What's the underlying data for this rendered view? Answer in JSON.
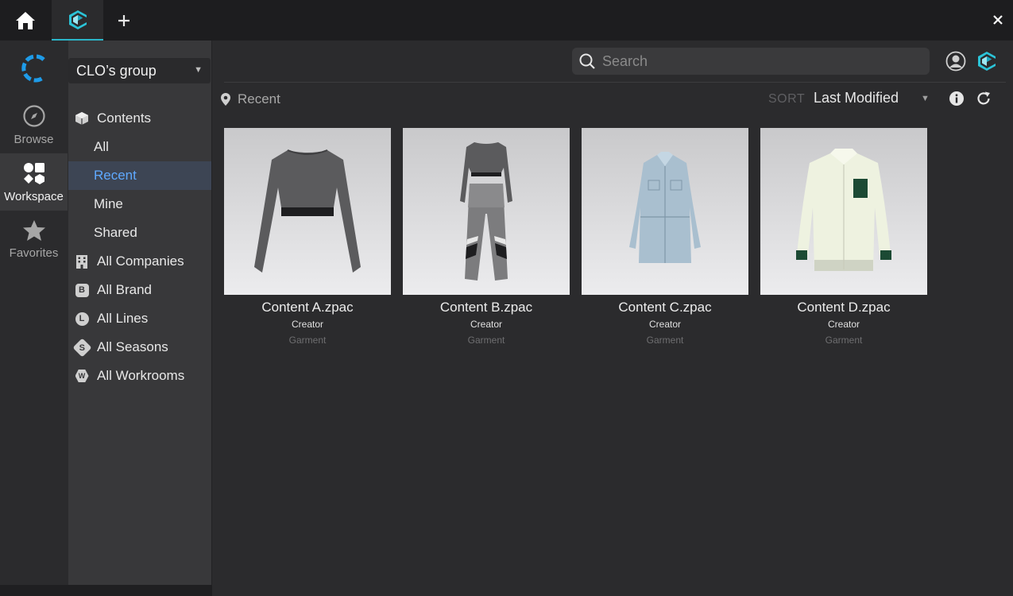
{
  "window": {
    "tabs": [
      {
        "icon": "home-icon"
      },
      {
        "icon": "clo-logo-icon",
        "active": true
      },
      {
        "icon": "plus-icon"
      }
    ],
    "close_icon": "close-icon"
  },
  "rail": {
    "logo": "clo-c-logo",
    "items": [
      {
        "label": "Browse",
        "icon": "compass-icon"
      },
      {
        "label": "Workspace",
        "icon": "shapes-icon",
        "active": true
      },
      {
        "label": "Favorites",
        "icon": "star-icon"
      }
    ]
  },
  "tree": {
    "group": "CLO’s group",
    "items": [
      {
        "label": "Contents",
        "icon": "box-icon"
      },
      {
        "label": "All"
      },
      {
        "label": "Recent",
        "active": true
      },
      {
        "label": "Mine"
      },
      {
        "label": "Shared"
      },
      {
        "label": "All Companies",
        "icon": "building-icon"
      },
      {
        "label": "All Brand",
        "icon": "brand-icon",
        "badge": "B"
      },
      {
        "label": "All Lines",
        "icon": "lines-icon",
        "badge": "L"
      },
      {
        "label": "All Seasons",
        "icon": "seasons-icon",
        "badge": "S"
      },
      {
        "label": "All Workrooms",
        "icon": "workroom-icon",
        "badge": "W"
      }
    ]
  },
  "header": {
    "search_placeholder": "Search",
    "breadcrumb": "Recent",
    "sort_label": "SORT",
    "sort_value": "Last Modified"
  },
  "cards": [
    {
      "name": "Content A.zpac",
      "creator": "Creator",
      "category": "Garment"
    },
    {
      "name": "Content B.zpac",
      "creator": "Creator",
      "category": "Garment"
    },
    {
      "name": "Content C.zpac",
      "creator": "Creator",
      "category": "Garment"
    },
    {
      "name": "Content D.zpac",
      "creator": "Creator",
      "category": "Garment"
    }
  ],
  "colors": {
    "accent": "#2bb5c9",
    "selected_text": "#5fa9ff",
    "logo_blue": "#1e9be8"
  }
}
